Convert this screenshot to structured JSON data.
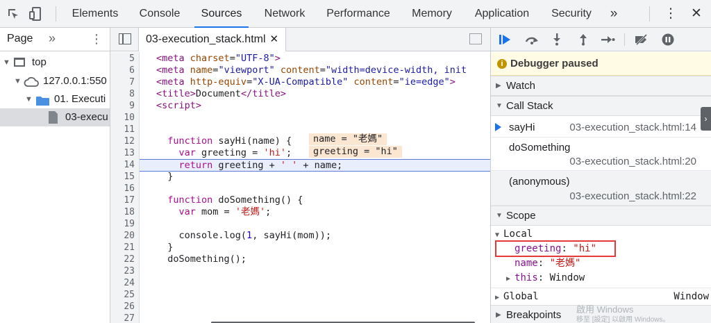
{
  "toolbar": {
    "tabs": [
      "Elements",
      "Console",
      "Sources",
      "Network",
      "Performance",
      "Memory",
      "Application",
      "Security"
    ],
    "active_tab": "Sources",
    "more": "»",
    "kebab": "⋮",
    "close": "✕"
  },
  "navigator": {
    "tab_label": "Page",
    "more": "»",
    "kebab": "⋮",
    "tree": [
      {
        "label": "top"
      },
      {
        "label": "127.0.0.1:550"
      },
      {
        "label": "01. Executi"
      },
      {
        "label": "03-execu"
      }
    ]
  },
  "editor": {
    "file_tab": "03-execution_stack.html",
    "close": "✕",
    "line_numbers": [
      "5",
      "6",
      "7",
      "8",
      "9",
      "10",
      "11",
      "12",
      "13",
      "14",
      "15",
      "16",
      "17",
      "18",
      "19",
      "20",
      "21",
      "22",
      "23",
      "24",
      "25",
      "26",
      "27"
    ],
    "inline_values": [
      "name = \"老媽\"",
      "greeting = \"hi\""
    ]
  },
  "debugger": {
    "paused_icon": "i",
    "paused_text": "Debugger paused",
    "sections": {
      "watch": "Watch",
      "call_stack": "Call Stack",
      "scope": "Scope",
      "breakpoints": "Breakpoints"
    },
    "call_stack": [
      {
        "fn": "sayHi",
        "loc": "03-execution_stack.html:14",
        "current": true
      },
      {
        "fn": "doSomething",
        "loc": "03-execution_stack.html:20",
        "current": false
      },
      {
        "fn": "(anonymous)",
        "loc": "03-execution_stack.html:22",
        "current": false
      }
    ],
    "scope": {
      "local_label": "Local",
      "vars": [
        {
          "name": "greeting",
          "value": "\"hi\""
        },
        {
          "name": "name",
          "value": "\"老媽\""
        },
        {
          "name": "this",
          "value": "Window"
        }
      ],
      "global_label": "Global",
      "global_value": "Window"
    },
    "watermark_line1": "啟用 Windows",
    "watermark_line2": "移至 [設定] 以啟用 Windows。"
  }
}
